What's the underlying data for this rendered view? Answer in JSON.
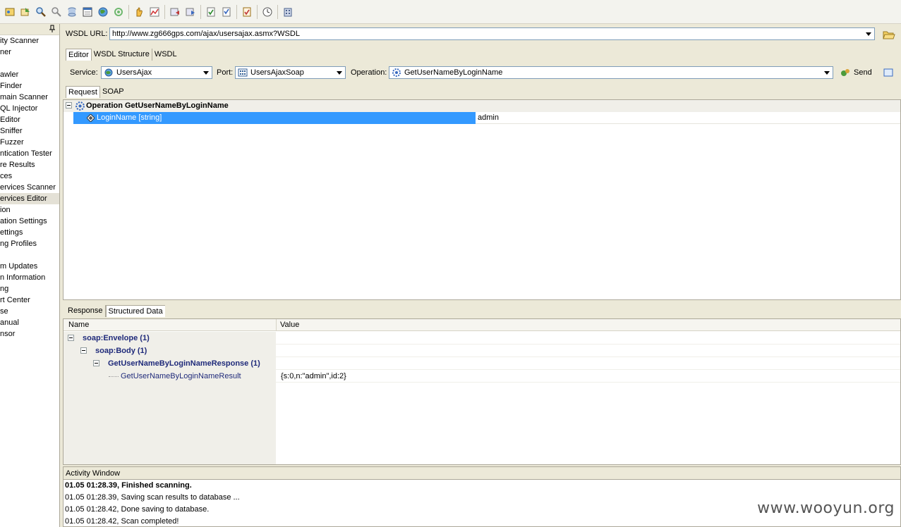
{
  "toolbar": {
    "icons": [
      "scan-icon",
      "import-icon",
      "search-icon",
      "find-icon",
      "database-icon",
      "report-icon",
      "globe-icon",
      "target-icon",
      "hand-icon",
      "chart-icon",
      "back-icon",
      "forward-icon",
      "page-check-icon",
      "list-check-icon",
      "task-icon",
      "clock-icon",
      "building-icon"
    ]
  },
  "sidebar": {
    "items": [
      {
        "label": "ity Scanner"
      },
      {
        "label": "ner"
      },
      {
        "label": ""
      },
      {
        "label": "awler"
      },
      {
        "label": " Finder"
      },
      {
        "label": "main Scanner"
      },
      {
        "label": "QL Injector"
      },
      {
        "label": "Editor"
      },
      {
        "label": "Sniffer"
      },
      {
        "label": "Fuzzer"
      },
      {
        "label": "ntication Tester"
      },
      {
        "label": "re Results"
      },
      {
        "label": "ces"
      },
      {
        "label": "ervices Scanner"
      },
      {
        "label": "ervices Editor"
      },
      {
        "label": "ion"
      },
      {
        "label": "ation Settings"
      },
      {
        "label": "ettings"
      },
      {
        "label": "ng Profiles"
      },
      {
        "label": ""
      },
      {
        "label": "m Updates"
      },
      {
        "label": "n Information"
      },
      {
        "label": "ng"
      },
      {
        "label": "rt Center"
      },
      {
        "label": "se"
      },
      {
        "label": "anual"
      },
      {
        "label": "nsor"
      }
    ]
  },
  "wsdl": {
    "label": "WSDL URL:",
    "value": "http://www.zg666gps.com/ajax/usersajax.asmx?WSDL"
  },
  "editor_tabs": [
    "Editor",
    "WSDL Structure",
    "WSDL"
  ],
  "service": {
    "label": "Service:",
    "value": "UsersAjax"
  },
  "port": {
    "label": "Port:",
    "value": "UsersAjaxSoap"
  },
  "operation": {
    "label": "Operation:",
    "value": "GetUserNameByLoginName"
  },
  "send_label": "Send",
  "request_tabs": [
    "Request",
    "SOAP"
  ],
  "request": {
    "operation_header": "Operation GetUserNameByLoginName",
    "param_name": "LoginName [string]",
    "param_value": "admin"
  },
  "response_tabs": [
    "Response",
    "Structured Data"
  ],
  "response": {
    "col_name": "Name",
    "col_value": "Value",
    "rows": [
      {
        "name": "soap:Envelope (1)",
        "value": ""
      },
      {
        "name": "soap:Body (1)",
        "value": ""
      },
      {
        "name": "GetUserNameByLoginNameResponse (1)",
        "value": ""
      },
      {
        "name": "GetUserNameByLoginNameResult",
        "value": "{s:0,n:\"admin\",id:2}"
      }
    ]
  },
  "activity": {
    "title": "Activity Window",
    "lines": [
      "01.05 01:28.39, Finished scanning.",
      "01.05 01:28.39, Saving scan results to database ...",
      "01.05 01:28.42, Done saving to database.",
      "01.05 01:28.42, Scan completed!"
    ]
  },
  "watermark": "www.wooyun.org",
  "colors": {
    "selection": "#3399ff",
    "tree_text": "#1f2a7a"
  }
}
